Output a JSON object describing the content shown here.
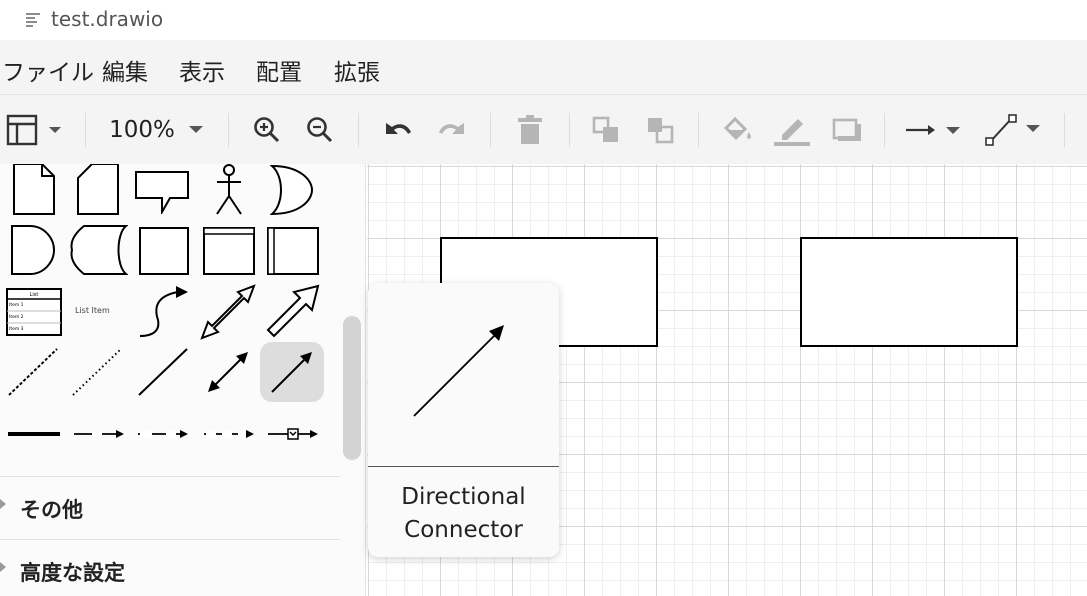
{
  "window": {
    "title": "test.drawio"
  },
  "menu": {
    "items": [
      "ファイル",
      "編集",
      "表示",
      "配置",
      "拡張"
    ]
  },
  "toolbar": {
    "zoom_label": "100%"
  },
  "sidebar": {
    "list_item_label": "List Item",
    "list_shape": {
      "header": "List",
      "rows": [
        "Item 1",
        "Item 2",
        "Item 3"
      ]
    },
    "sections": [
      {
        "label": "その他"
      },
      {
        "label": "高度な設定"
      }
    ]
  },
  "tooltip": {
    "title_line1": "Directional",
    "title_line2": "Connector"
  },
  "colors": {
    "menu_bg": "#f4f4f4",
    "selected_bg": "#dddddd",
    "disabled_icon": "#b5b5b5",
    "grid_major": "#d8d8d8"
  }
}
